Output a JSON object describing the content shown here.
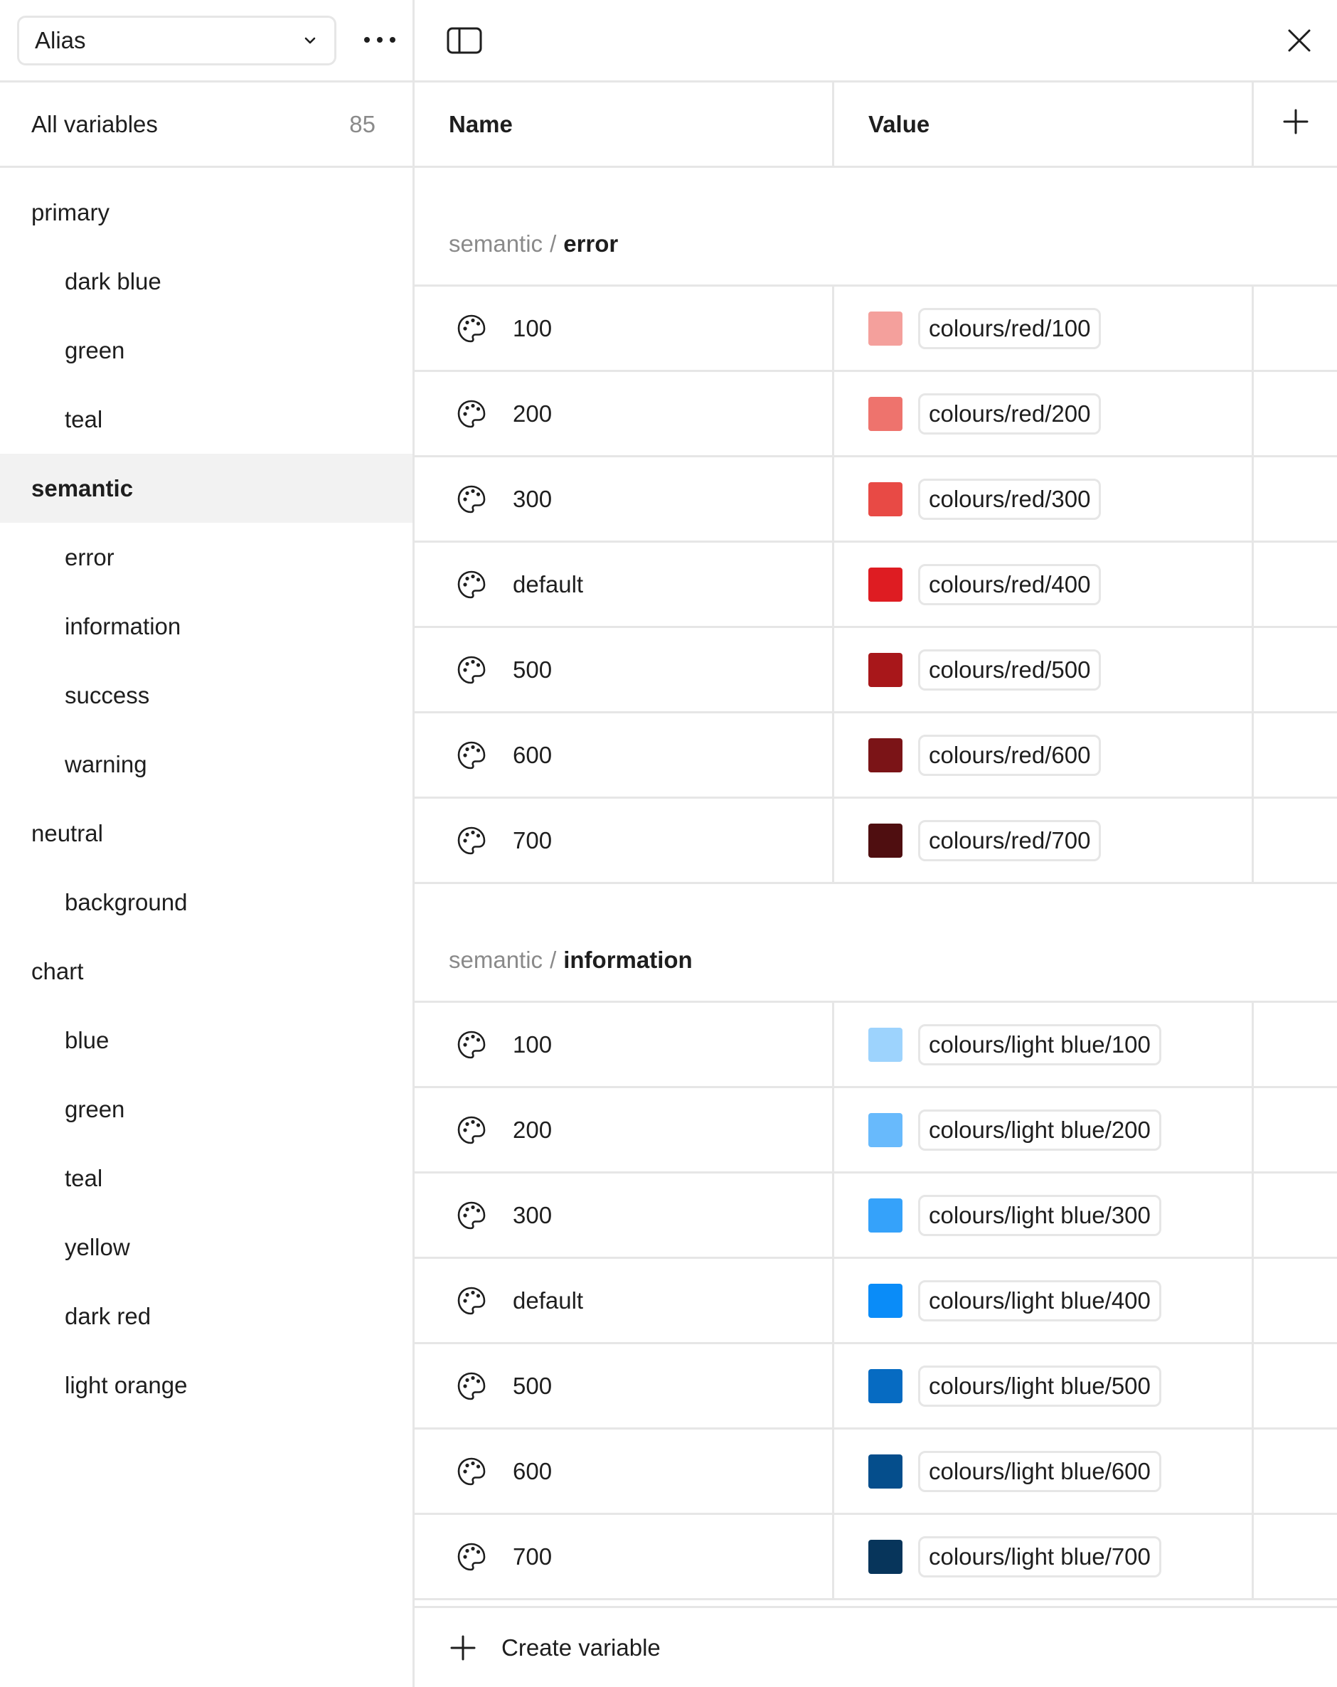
{
  "sidebar": {
    "mode_select": {
      "label": "Alias"
    },
    "all_variables": {
      "label": "All variables",
      "count": "85"
    },
    "groups": [
      {
        "label": "primary",
        "level": 0,
        "active": false
      },
      {
        "label": "dark blue",
        "level": 1,
        "active": false
      },
      {
        "label": "green",
        "level": 1,
        "active": false
      },
      {
        "label": "teal",
        "level": 1,
        "active": false
      },
      {
        "label": "semantic",
        "level": 0,
        "active": true
      },
      {
        "label": "error",
        "level": 1,
        "active": false
      },
      {
        "label": "information",
        "level": 1,
        "active": false
      },
      {
        "label": "success",
        "level": 1,
        "active": false
      },
      {
        "label": "warning",
        "level": 1,
        "active": false
      },
      {
        "label": "neutral",
        "level": 0,
        "active": false
      },
      {
        "label": "background",
        "level": 1,
        "active": false
      },
      {
        "label": "chart",
        "level": 0,
        "active": false
      },
      {
        "label": "blue",
        "level": 1,
        "active": false
      },
      {
        "label": "green",
        "level": 1,
        "active": false
      },
      {
        "label": "teal",
        "level": 1,
        "active": false
      },
      {
        "label": "yellow",
        "level": 1,
        "active": false
      },
      {
        "label": "dark red",
        "level": 1,
        "active": false
      },
      {
        "label": "light orange",
        "level": 1,
        "active": false
      }
    ]
  },
  "table": {
    "headers": {
      "name": "Name",
      "value": "Value"
    },
    "sections": [
      {
        "path": "semantic",
        "separator": "/",
        "leaf": "error",
        "rows": [
          {
            "name": "100",
            "alias": "colours/red/100",
            "color": "#f4a09c"
          },
          {
            "name": "200",
            "alias": "colours/red/200",
            "color": "#ee736d"
          },
          {
            "name": "300",
            "alias": "colours/red/300",
            "color": "#e84a45"
          },
          {
            "name": "default",
            "alias": "colours/red/400",
            "color": "#de1c22"
          },
          {
            "name": "500",
            "alias": "colours/red/500",
            "color": "#a8171a"
          },
          {
            "name": "600",
            "alias": "colours/red/600",
            "color": "#7b1417"
          },
          {
            "name": "700",
            "alias": "colours/red/700",
            "color": "#4f0e10"
          }
        ]
      },
      {
        "path": "semantic",
        "separator": "/",
        "leaf": "information",
        "rows": [
          {
            "name": "100",
            "alias": "colours/light blue/100",
            "color": "#9dd3fd"
          },
          {
            "name": "200",
            "alias": "colours/light blue/200",
            "color": "#68bafc"
          },
          {
            "name": "300",
            "alias": "colours/light blue/300",
            "color": "#35a2fa"
          },
          {
            "name": "default",
            "alias": "colours/light blue/400",
            "color": "#0a8cf8"
          },
          {
            "name": "500",
            "alias": "colours/light blue/500",
            "color": "#066bc2"
          },
          {
            "name": "600",
            "alias": "colours/light blue/600",
            "color": "#054e8c"
          },
          {
            "name": "700",
            "alias": "colours/light blue/700",
            "color": "#07355b"
          }
        ]
      }
    ]
  },
  "footer": {
    "create_label": "Create variable"
  },
  "icons": {
    "row_icon": "palette-icon",
    "mode_chevron": "chevron-down-icon",
    "more": "more-horizontal-icon",
    "toggle": "sidebar-toggle-icon",
    "close": "close-icon",
    "add": "plus-icon"
  },
  "colors": {
    "border": "#e6e6e6",
    "active_bg": "#f2f2f2",
    "muted_text": "#8a8a8a",
    "text": "#1e1e1e"
  }
}
